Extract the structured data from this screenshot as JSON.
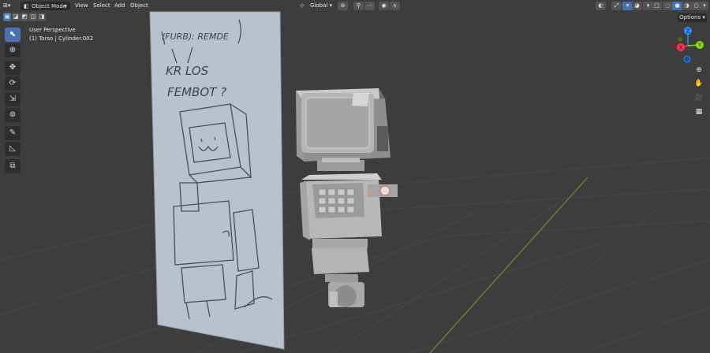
{
  "header": {
    "mode": "Object Mode",
    "menus": [
      "View",
      "Select",
      "Add",
      "Object"
    ],
    "orientation": "Global",
    "options_label": "Options"
  },
  "overlay": {
    "view_name": "User Perspective",
    "object_info": "(1) Torso | Cylinder.002"
  },
  "reference_sketch_text": {
    "line1": "(FURB): REMDE",
    "line2": "KR LOS",
    "line3": "FEMBOT ?"
  },
  "gizmo": {
    "z": "Z",
    "y": "Y",
    "x": "X"
  },
  "colors": {
    "viewport": "#3d3d3d",
    "accent": "#4772b3",
    "x_axis": "#ff3352",
    "y_axis": "#8bdc00",
    "z_axis": "#2890ff"
  },
  "icons": {
    "toolbar": [
      "select-box-icon",
      "cursor-icon",
      "move-icon",
      "rotate-icon",
      "scale-icon",
      "transform-icon",
      "annotate-icon",
      "measure-icon",
      "add-cube-icon"
    ],
    "navigation": [
      "zoom-icon",
      "hand-pan-icon",
      "camera-icon",
      "grid-view-icon"
    ]
  }
}
